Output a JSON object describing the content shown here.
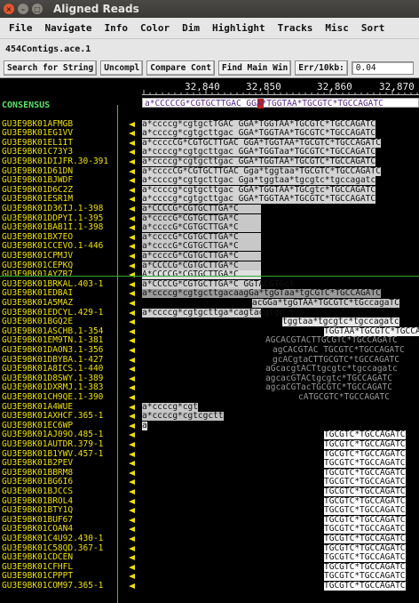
{
  "window": {
    "title": "Aligned Reads",
    "controls": [
      "close-icon",
      "minimize-icon",
      "maximize-icon"
    ]
  },
  "menu": [
    "File",
    "Navigate",
    "Info",
    "Color",
    "Dim",
    "Highlight",
    "Tracks",
    "Misc",
    "Sort"
  ],
  "file": "454Contigs.ace.1",
  "toolbar": {
    "search": "Search for String",
    "uncompl": "Uncompl",
    "compare": "Compare Cont",
    "find": "Find Main Win",
    "err_label": "Err/10kb:",
    "err_value": "0.04"
  },
  "ruler": [
    "32,840",
    "32,850",
    "32,860",
    "32,870"
  ],
  "consensus": {
    "label": "CONSENSUS",
    "seq": "a*CCCCCG*CGTGCTTGAC GGA*TGGTAA*TGCGTC*TGCCAGATC"
  },
  "reads": [
    {
      "name": "GU3E9BK01AFMGB",
      "seq": "a*ccccg*cgtgctTGAC GGA*TGGTAA*TGCGTC*TGCCAGATC"
    },
    {
      "name": "GU3E9BK01EG1VV",
      "seq": "a*ccccg*cgtgcttgac GGA*TGGTAA*TGCGTC*TGCCAGATC"
    },
    {
      "name": "GU3E9BK01EL1IT",
      "seq": "a*ccccCG*CGTGCTTGAC GGA*TGGTAA*TGCGTC*TGCCAGATC"
    },
    {
      "name": "GU3E9BK01C73Y3",
      "seq": "a*ccccg*cgtgcttgac GGA*TGGTaa*TGCGTC*TGCCAGATC"
    },
    {
      "name": "GU3E9BK01DIJFR.30-391",
      "seq": "a*ccccg*cgtgcttgac GGA*TGGTAA*TGCGTC*TGCCAGATC"
    },
    {
      "name": "GU3E9BK01D61DN",
      "seq": "a*ccccCG*CGTGCTTGAC Gga*tggtaa*TGCGTC*TGCCAGATC"
    },
    {
      "name": "GU3E9BK01BJWDF",
      "seq": "a*ccccg*cgtgcttgac Gga*tggtaa*tgcgtc*tgccagatc"
    },
    {
      "name": "GU3E9BK01D6C2Z",
      "seq": "a*ccccg*cgtgcttgac GGA*TGGTAA*TGCgtc*TGCCAGATC"
    },
    {
      "name": "GU3E9BK01ESR1M",
      "seq": "a*ccccg*cgtgcttgac GGA*TGGTAA*TGCGTC*TGCCAGATC"
    },
    {
      "name": "GU3E9BK01D36IJ.1-398",
      "seq": "a*CCCCG*CGTGCTTGA*C"
    },
    {
      "name": "GU3E9BK01DDPYI.1-395",
      "seq": "a*ccccG*CGTGCTTGA*C"
    },
    {
      "name": "GU3E9BK01BAB1I.1-398",
      "seq": "a*ccccG*CGTGCTTGA*C"
    },
    {
      "name": "GU3E9BK01BX7EO",
      "seq": "a*ccccG*CGTGCTTGA*C"
    },
    {
      "name": "GU3E9BK01CCEVO.1-446",
      "seq": "a*ccccG*CGTGCTTGA*C"
    },
    {
      "name": "GU3E9BK01CPMJV",
      "seq": "a*ccccG*CGTGCTTGA*C"
    },
    {
      "name": "GU3E9BK01CEPKQ",
      "seq": "a*CCCCG*CGTGCTTGA*C"
    },
    {
      "name": "GU3E9BK01AYZR7",
      "seq": "A*CCCCG*CGTGCTTGA*C"
    },
    {
      "name": "GU3E9BK01BRKAL.403-1",
      "seq": "a*CCCCG*CGTGCTTGA*C GGTACGTGct"
    },
    {
      "name": "GU3E9BK01EDBAI",
      "seq": "a*ccccg*cgtgcttgacaagGa*tgGTaa*tgCGTC*TGCCAGATC"
    },
    {
      "name": "GU3E9BK01A5MAZ",
      "seq": "acGGa*tgGTAA*TGCGTC*tGccagaTC"
    },
    {
      "name": "GU3E9BK01EDCYL.429-1",
      "seq": "a*ccccg*cgtgcttga*cagtacgtgc"
    },
    {
      "name": "GU3E9BK01BGQ2E",
      "seq": "tggtaa*tgcgtc*tgccagatc"
    },
    {
      "name": "GU3E9BK01ASCHB.1-354",
      "seq": "TGGTAA*TGCGTC*TGCCAGATC"
    },
    {
      "name": "GU3E9BK01EM9TN.1-381",
      "seq": "AGCACGTACTTGCGTC*TGCCAGATC"
    },
    {
      "name": "GU3E9BK01DAON3.1-356",
      "seq": "agCACGTAC TGCGTC*TGCCAGATC"
    },
    {
      "name": "GU3E9BK01DBYBA.1-427",
      "seq": "gcACgtaCTTGCGTC*tGCCAGATC"
    },
    {
      "name": "GU3E9BK01A8ICS.1-440",
      "seq": "aGcacgtACTtgcgtc*tgccagatc"
    },
    {
      "name": "GU3E9BK01D8SWY.1-389",
      "seq": "agcacGTACtgcgtc*TGCCAGATC"
    },
    {
      "name": "GU3E9BK01DXRMJ.1-383",
      "seq": "agcaCGTacTGCGTC*TGCCAGATC"
    },
    {
      "name": "GU3E9BK01CH9QE.1-390",
      "seq": "cATGCGTC*TGCCAGATC"
    },
    {
      "name": "GU3E9BK01A4WUE",
      "seq": "a*ccccg*cgt"
    },
    {
      "name": "GU3E9BK01AXHCF.365-1",
      "seq": "a*ccccg*cgtcgctt"
    },
    {
      "name": "GU3E9BK01EC6WP",
      "seq": "a"
    },
    {
      "name": "GU3E9BK01AJ09O.485-1",
      "seq": "TGCGTC*TGCCAGATC"
    },
    {
      "name": "GU3E9BK01AUTDR.379-1",
      "seq": "TGCGTC*TGCCAGATC"
    },
    {
      "name": "GU3E9BK01B1YWV.457-1",
      "seq": "TGCGTC*TGCCAGATC"
    },
    {
      "name": "GU3E9BK01B2PEV",
      "seq": "TGCGTC*TGCCAGATC"
    },
    {
      "name": "GU3E9BK01BBRM8",
      "seq": "TGCGTC*TGCCAGATC"
    },
    {
      "name": "GU3E9BK01BG6I6",
      "seq": "TGCGTC*TGCCAGATC"
    },
    {
      "name": "GU3E9BK01BJCCS",
      "seq": "TGCGTC*TGCCAGATC"
    },
    {
      "name": "GU3E9BK01BROL4",
      "seq": "TGCGTC*TGCCAGATC"
    },
    {
      "name": "GU3E9BK01BTY1Q",
      "seq": "TGCGTC*TGCCAGATC"
    },
    {
      "name": "GU3E9BK01BUF67",
      "seq": "TGCGTC*TGCCAGATC"
    },
    {
      "name": "GU3E9BK01COAN4",
      "seq": "TGCGTC*TGCCAGATC"
    },
    {
      "name": "GU3E9BK01C4U92.430-1",
      "seq": "TGCGTC*TGCCAGATC"
    },
    {
      "name": "GU3E9BK01C58QD.367-1",
      "seq": "TGCGTC*TGCCAGATC"
    },
    {
      "name": "GU3E9BK01CDCEN",
      "seq": "TGCGTC*TGCCAGATC"
    },
    {
      "name": "GU3E9BK01CFHFL",
      "seq": "TGCGTC*TGCCAGATC"
    },
    {
      "name": "GU3E9BK01CPPPT",
      "seq": "TGCGTC*TGCCAGATC"
    },
    {
      "name": "GU3E9BK01COM97.365-1",
      "seq": "TGCGTC*TGCCAGATC"
    }
  ]
}
